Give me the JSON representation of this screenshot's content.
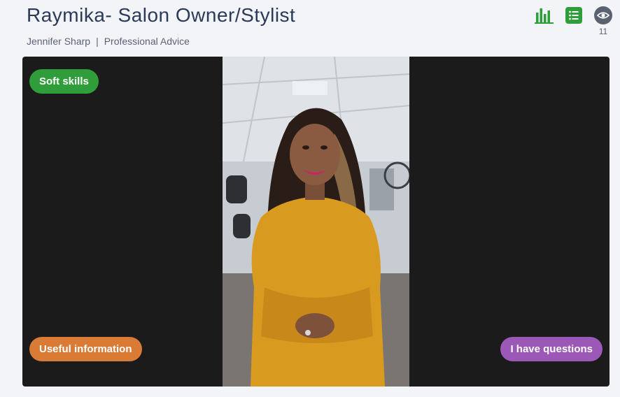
{
  "header": {
    "title": "Raymika- Salon Owner/Stylist",
    "author": "Jennifer Sharp",
    "separator": "|",
    "category": "Professional Advice"
  },
  "toolbar": {
    "stats_icon": "bar-chart-icon",
    "list_icon": "list-icon",
    "views_icon": "eye-icon",
    "views_count": "11",
    "accent_color": "#2f9e3a"
  },
  "video": {
    "tags": {
      "soft_skills": "Soft skills",
      "useful_information": "Useful information",
      "questions": "I have questions"
    },
    "tag_colors": {
      "soft_skills": "#2f9e3a",
      "useful_information": "#d97b34",
      "questions": "#9b58b6"
    }
  }
}
